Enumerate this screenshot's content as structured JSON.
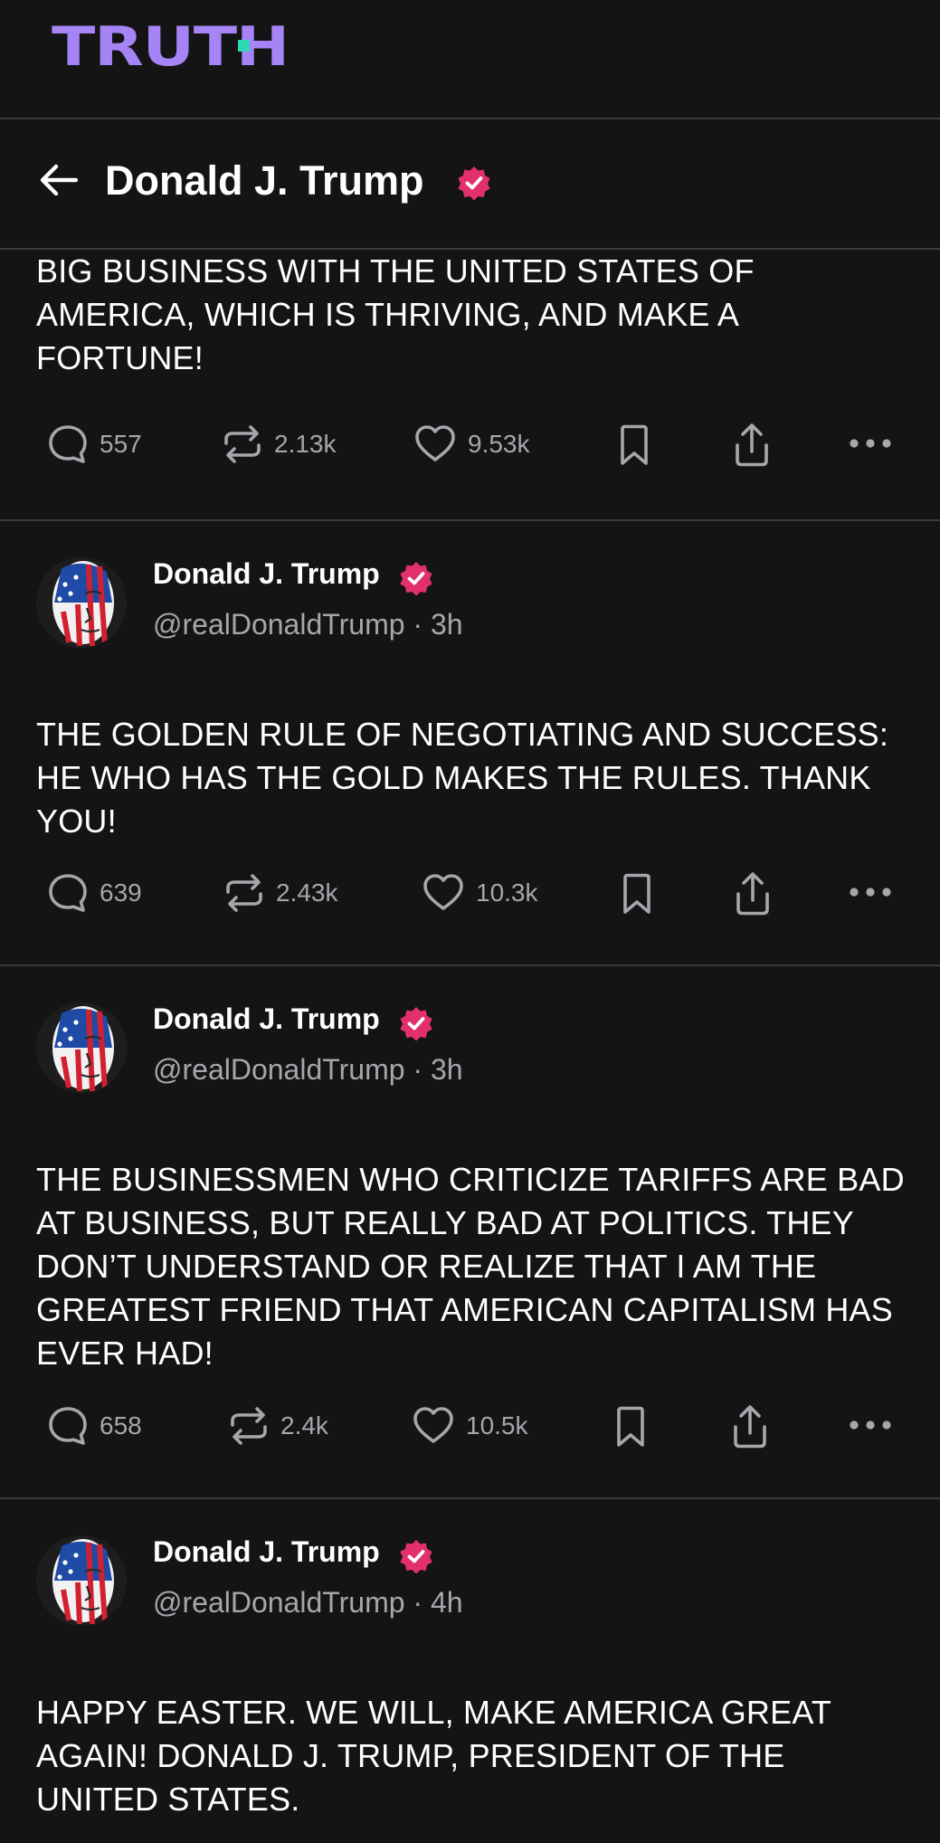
{
  "app": {
    "logo_text": "TRUTH",
    "accent": "#a784f5",
    "logo_dot_color": "#2fd6b4",
    "badge_color": "#e2306c"
  },
  "header": {
    "title": "Donald J. Trump",
    "back_icon": "arrow-left-icon",
    "verified_icon": "verified-badge-icon"
  },
  "posts": [
    {
      "text": "BIG BUSINESS WITH THE UNITED STATES OF AMERICA, WHICH IS THRIVING, AND MAKE A FORTUNE!",
      "replies": "557",
      "retruths": "2.13k",
      "likes": "9.53k"
    },
    {
      "author": "Donald J. Trump",
      "handle": "@realDonaldTrump",
      "time": "3h",
      "text": "THE GOLDEN RULE OF NEGOTIATING AND SUCCESS: HE WHO HAS THE GOLD MAKES THE RULES. THANK YOU!",
      "replies": "639",
      "retruths": "2.43k",
      "likes": "10.3k"
    },
    {
      "author": "Donald J. Trump",
      "handle": "@realDonaldTrump",
      "time": "3h",
      "text": "THE BUSINESSMEN WHO CRITICIZE TARIFFS ARE BAD AT BUSINESS, BUT REALLY BAD AT POLITICS. THEY DON’T UNDERSTAND OR REALIZE THAT I AM THE GREATEST FRIEND THAT AMERICAN CAPITALISM HAS EVER HAD!",
      "replies": "658",
      "retruths": "2.4k",
      "likes": "10.5k"
    },
    {
      "author": "Donald J. Trump",
      "handle": "@realDonaldTrump",
      "time": "4h",
      "text": "HAPPY EASTER. WE WILL, MAKE AMERICA GREAT AGAIN! DONALD J. TRUMP, PRESIDENT OF THE UNITED STATES."
    }
  ],
  "icons": [
    "reply-icon",
    "retruth-icon",
    "like-icon",
    "bookmark-icon",
    "share-icon",
    "more-options-icon"
  ]
}
